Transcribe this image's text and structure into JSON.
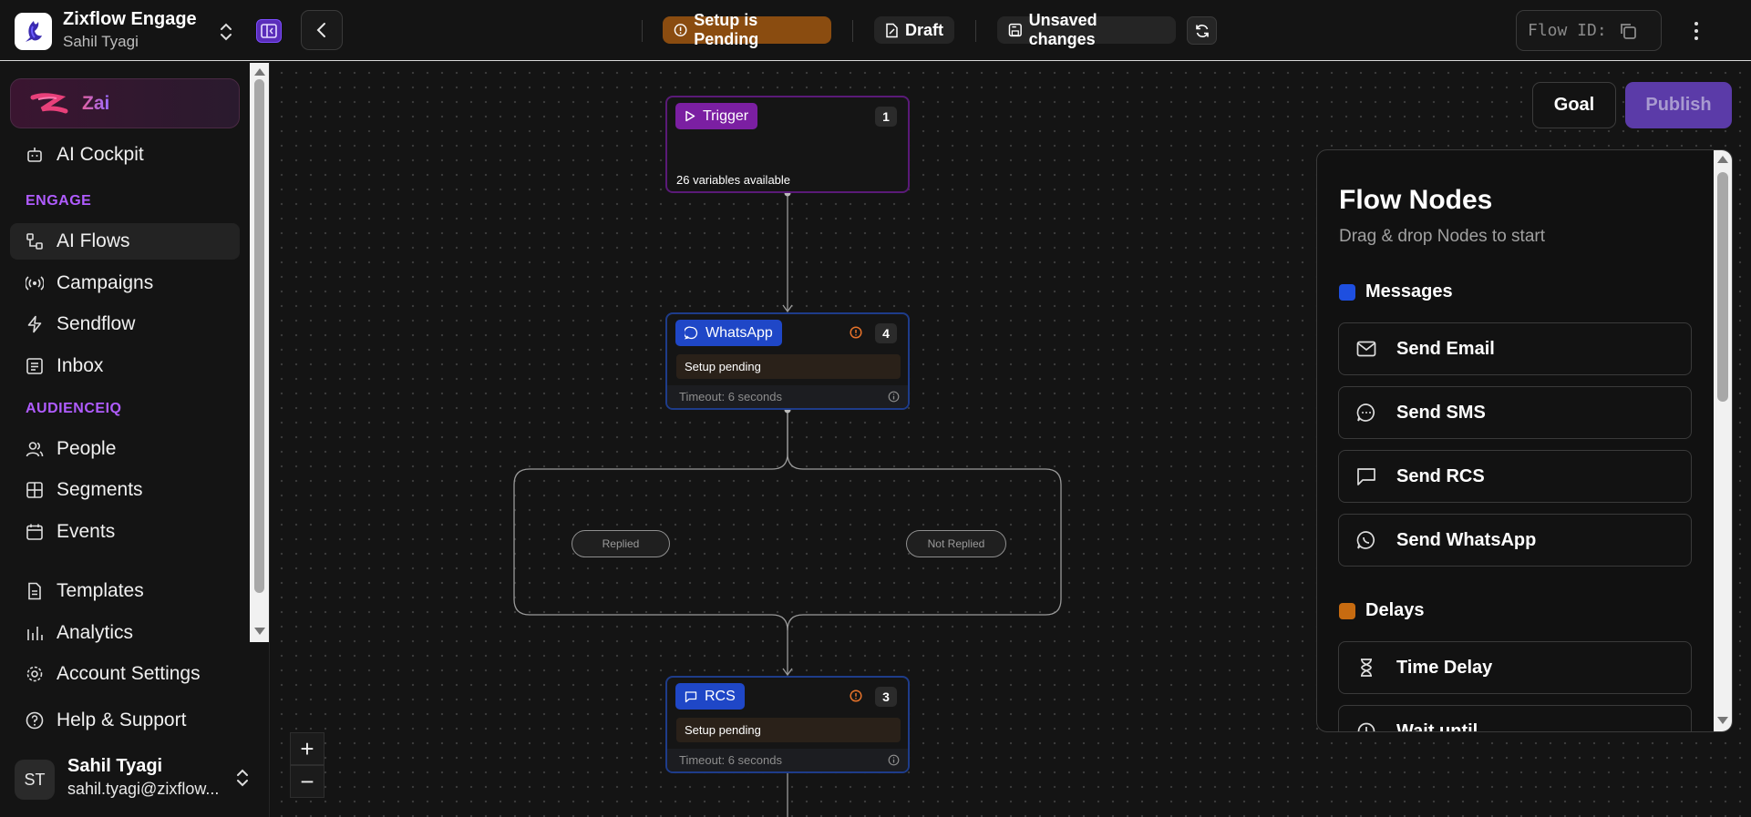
{
  "header": {
    "app_title": "Zixflow Engage",
    "workspace_user": "Sahil Tyagi",
    "status_pending": "Setup is Pending",
    "status_draft": "Draft",
    "status_unsaved": "Unsaved changes",
    "flow_id_label": "Flow ID:"
  },
  "sidebar": {
    "zai_label": "Zai",
    "top_items": [
      {
        "label": "AI Cockpit",
        "icon": "robot-icon"
      }
    ],
    "section_engage": "ENGAGE",
    "engage_items": [
      {
        "label": "AI Flows",
        "icon": "flow-icon",
        "active": true
      },
      {
        "label": "Campaigns",
        "icon": "broadcast-icon"
      },
      {
        "label": "Sendflow",
        "icon": "lightning-icon"
      },
      {
        "label": "Inbox",
        "icon": "inbox-icon"
      }
    ],
    "section_audience": "AUDIENCEIQ",
    "audience_items": [
      {
        "label": "People",
        "icon": "people-icon"
      },
      {
        "label": "Segments",
        "icon": "grid-icon"
      },
      {
        "label": "Events",
        "icon": "calendar-icon"
      }
    ],
    "bottom_items": [
      {
        "label": "Templates",
        "icon": "document-icon"
      },
      {
        "label": "Analytics",
        "icon": "bar-chart-icon"
      },
      {
        "label": "Account Settings",
        "icon": "gear-icon"
      },
      {
        "label": "Help & Support",
        "icon": "help-icon"
      }
    ],
    "user": {
      "initials": "ST",
      "name": "Sahil Tyagi",
      "email": "sahil.tyagi@zixflow..."
    }
  },
  "canvas": {
    "trigger": {
      "label": "Trigger",
      "count": "1",
      "info": "26 variables available"
    },
    "whatsapp": {
      "label": "WhatsApp",
      "count": "4",
      "status": "Setup pending",
      "timeout": "Timeout: 6 seconds"
    },
    "rcs": {
      "label": "RCS",
      "count": "3",
      "status": "Setup pending",
      "timeout": "Timeout: 6 seconds"
    },
    "branch_replied": "Replied",
    "branch_not_replied": "Not Replied",
    "zoom_in": "+",
    "zoom_out": "−"
  },
  "actions": {
    "goal": "Goal",
    "publish": "Publish"
  },
  "panel": {
    "title": "Flow Nodes",
    "subtitle": "Drag & drop Nodes to start",
    "messages_label": "Messages",
    "messages_color": "#1e4fe0",
    "messages": [
      {
        "label": "Send Email",
        "icon": "mail-icon"
      },
      {
        "label": "Send SMS",
        "icon": "chat-bubble-icon"
      },
      {
        "label": "Send RCS",
        "icon": "message-square-icon"
      },
      {
        "label": "Send WhatsApp",
        "icon": "whatsapp-icon"
      }
    ],
    "delays_label": "Delays",
    "delays_color": "#c76b10",
    "delays": [
      {
        "label": "Time Delay",
        "icon": "hourglass-icon"
      },
      {
        "label": "Wait until",
        "icon": "clock-icon"
      }
    ]
  }
}
